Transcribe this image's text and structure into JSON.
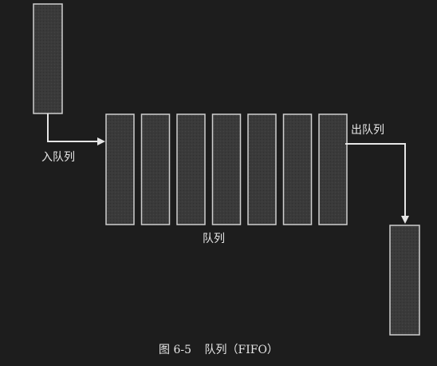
{
  "diagram": {
    "enqueue_label": "入队列",
    "dequeue_label": "出队列",
    "queue_label": "队列",
    "queue_slot_count": 7
  },
  "caption": {
    "number": "图 6-5",
    "text": "队列（FIFO）"
  },
  "colors": {
    "background": "#1d1d1d",
    "box_fill": "#3a3a3a",
    "box_stroke": "#cfcfcf",
    "arrow": "#e6e6e6"
  }
}
